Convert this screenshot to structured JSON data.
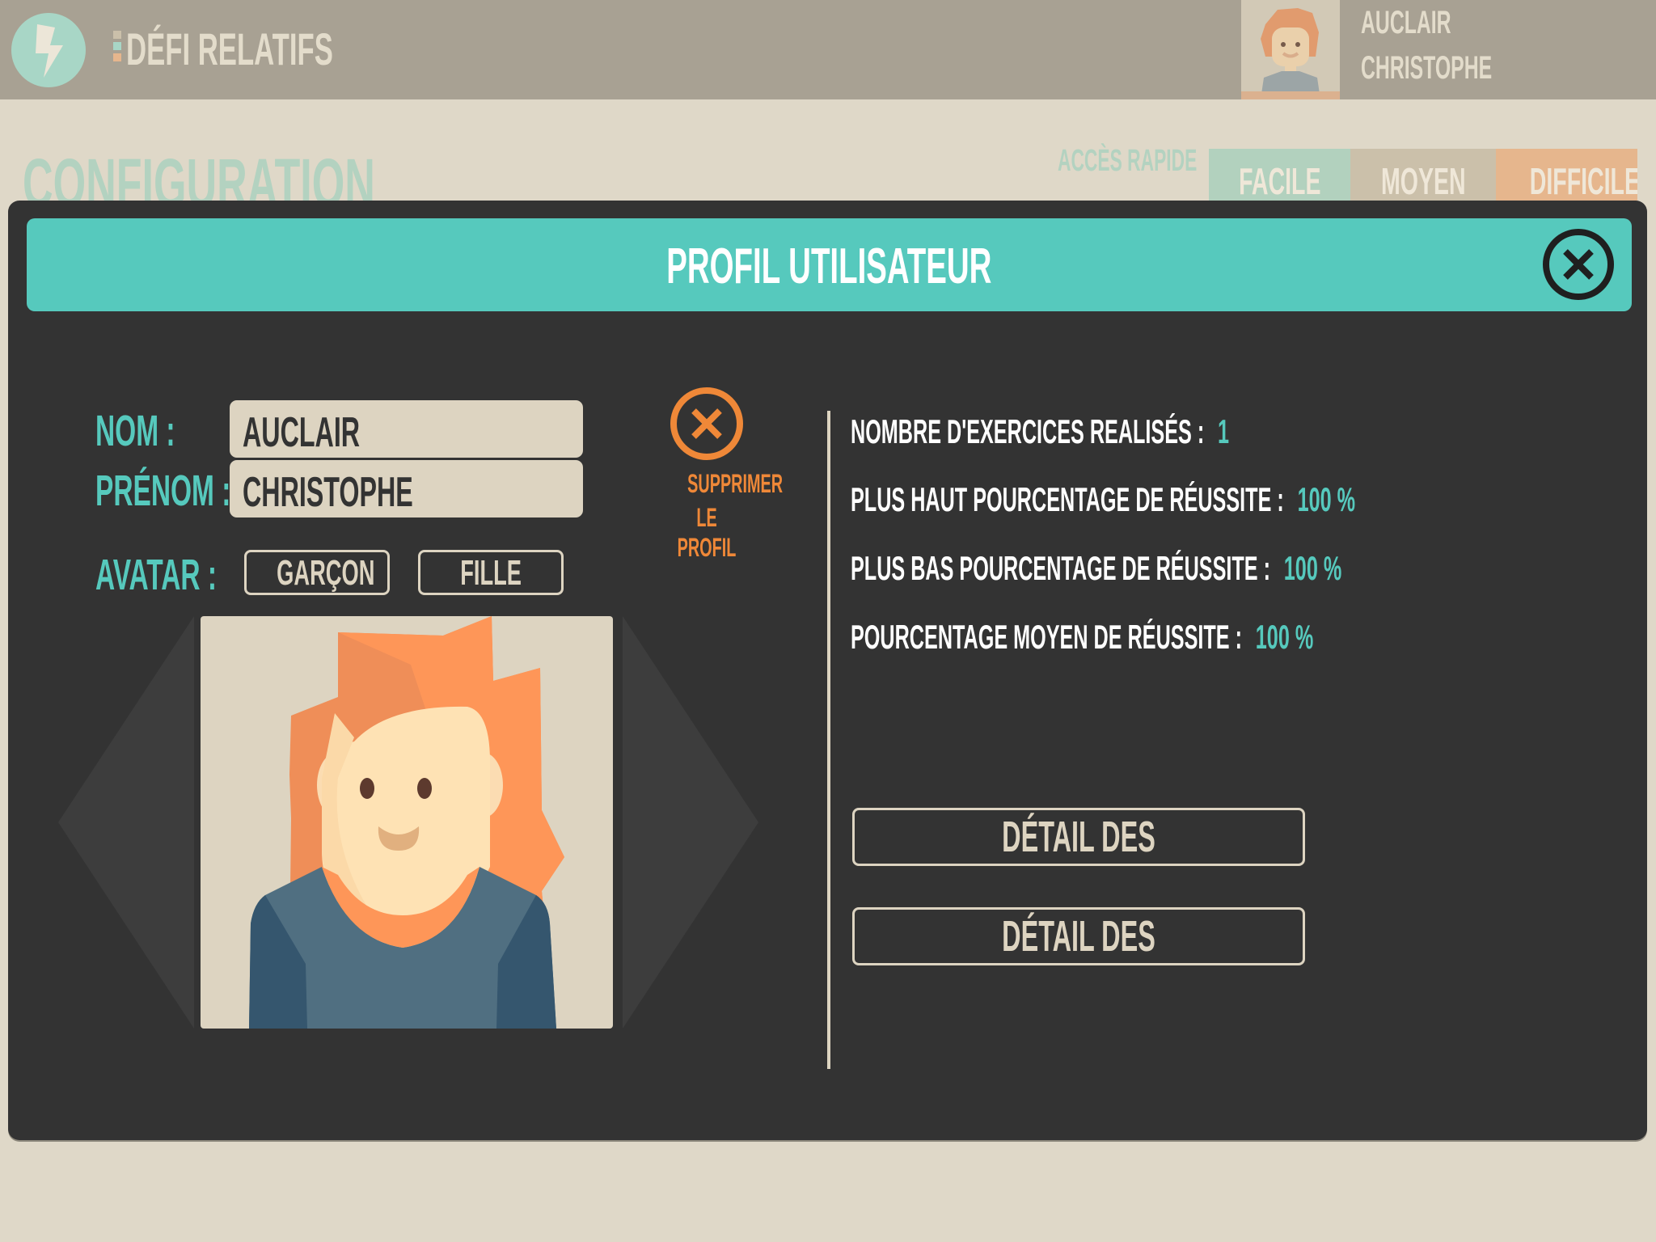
{
  "app": {
    "title": "DÉFI RELATIFS",
    "logo_icon": "lightning-bolt-icon",
    "title_stripe_colors": [
      "#cbc0aa",
      "#a8d6c6",
      "#e6b68d"
    ]
  },
  "current_user": {
    "last_name": "AUCLAIR",
    "first_name": "CHRISTOPHE",
    "avatar": "boy-avatar"
  },
  "background_page": {
    "title": "CONFIGURATION",
    "quick_access_label": "ACCÈS RAPIDE",
    "quick_tabs": [
      {
        "label": "FACILE",
        "color": "#b2d1be"
      },
      {
        "label": "MOYEN",
        "color": "#cbc0aa"
      },
      {
        "label": "DIFFICILE",
        "color": "#e6b68d"
      }
    ]
  },
  "modal": {
    "title": "PROFIL UTILISATEUR",
    "close_icon": "close-circle-icon",
    "form": {
      "nom_label": "NOM :",
      "nom_value": "AUCLAIR",
      "prenom_label": "PRÉNOM :",
      "prenom_value": "CHRISTOPHE",
      "avatar_label": "AVATAR :",
      "avatar_options": [
        "GARÇON",
        "FILLE"
      ],
      "selected_avatar": "boy-red-hair"
    },
    "delete": {
      "line1": "SUPPRIMER",
      "line2": "LE PROFIL",
      "icon": "delete-circle-icon"
    },
    "stats": [
      {
        "label": "NOMBRE D'EXERCICES REALISÉS :",
        "value": "1"
      },
      {
        "label": "PLUS HAUT POURCENTAGE DE RÉUSSITE :",
        "value": "100 %"
      },
      {
        "label": "PLUS BAS POURCENTAGE DE RÉUSSITE :",
        "value": "100 %"
      },
      {
        "label": "POURCENTAGE MOYEN DE RÉUSSITE :",
        "value": "100 %"
      }
    ],
    "buttons": {
      "table": "DÉTAIL DES EXERCICES (TABLEAU)",
      "chart": "DÉTAIL DES EXERCICES (GRAPHIQUE)"
    }
  },
  "colors": {
    "accent_teal": "#56c9bd",
    "accent_orange": "#ef8838",
    "modal_bg": "#333333",
    "page_bg": "#dfd8c8",
    "topbar_bg": "#a8a193"
  }
}
